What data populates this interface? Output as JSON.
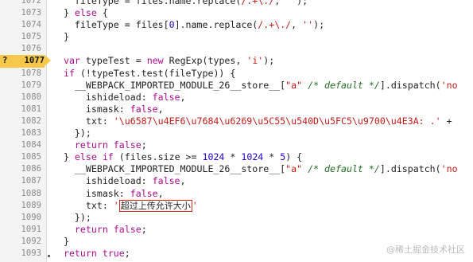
{
  "editor": {
    "paused_line": "1077",
    "paused_icon": "?",
    "watermark": "@稀土掘金技术社区",
    "lines": [
      {
        "ln": "1072",
        "src": "    fileType = files.name.replace(/.+\\./, '');"
      },
      {
        "ln": "1073",
        "src": "  } else {"
      },
      {
        "ln": "1074",
        "src": "    fileType = files[0].name.replace(/.+\\./, '');"
      },
      {
        "ln": "1075",
        "src": "  }"
      },
      {
        "ln": "1076",
        "src": ""
      },
      {
        "ln": "1077",
        "src": "  var typeTest = new RegExp(types, 'i');"
      },
      {
        "ln": "1078",
        "src": "  if (!typeTest.test(fileType)) {"
      },
      {
        "ln": "1079",
        "src": "    __WEBPACK_IMPORTED_MODULE_26__store__[\"a\" /* default */].dispatch('no"
      },
      {
        "ln": "1080",
        "src": "      ishideload: false,"
      },
      {
        "ln": "1081",
        "src": "      ismask: false,"
      },
      {
        "ln": "1082",
        "src": "      txt: '\\u6587\\u4EF6\\u7684\\u6269\\u5C55\\u540D\\u5FC5\\u9700\\u4E3A: .' + "
      },
      {
        "ln": "1083",
        "src": "    });"
      },
      {
        "ln": "1084",
        "src": "    return false;"
      },
      {
        "ln": "1085",
        "src": "  } else if (files.size >= 1024 * 1024 * 5) {"
      },
      {
        "ln": "1086",
        "src": "    __WEBPACK_IMPORTED_MODULE_26__store__[\"a\" /* default */].dispatch('no"
      },
      {
        "ln": "1087",
        "src": "      ishideload: false,"
      },
      {
        "ln": "1088",
        "src": "      ismask: false,"
      },
      {
        "ln": "1089",
        "src": "      txt: '超过上传允许大小'"
      },
      {
        "ln": "1090",
        "src": "    });"
      },
      {
        "ln": "1091",
        "src": "    return false;"
      },
      {
        "ln": "1092",
        "src": "  }"
      },
      {
        "ln": "1093",
        "src": "  return true;"
      }
    ]
  }
}
